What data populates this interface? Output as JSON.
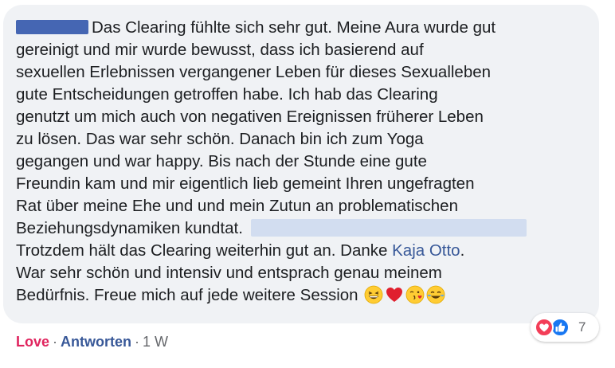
{
  "comment": {
    "lines": [
      "Das Clearing fühlte sich sehr gut. Meine Aura wurde gut",
      "gereinigt und mir wurde bewusst, dass ich basierend auf",
      "sexuellen Erlebnissen vergangener Leben für dieses Sexualleben",
      "gute Entscheidungen getroffen habe. Ich hab das Clearing",
      "genutzt um mich auch von negativen Ereignissen früherer Leben",
      "zu lösen. Das war sehr schön. Danach bin ich zum Yoga",
      "gegangen und war happy. Bis nach der Stunde eine gute",
      "Freundin kam und mir eigentlich lieb gemeint Ihren ungefragten",
      "Rat über meine Ehe und und mein Zutun an problematischen",
      "Beziehungsdynamiken kundtat.",
      "Trotzdem hält das Clearing weiterhin gut an. Danke ",
      "War sehr schön und intensiv und entsprach genau meinem",
      "Bedürfnis. Freue mich auf jede weitere Session"
    ],
    "mention": "Kaja Otto",
    "mention_suffix": ".",
    "emojis": [
      "grinning-squinting-face",
      "red-heart",
      "face-blowing-kiss",
      "face-with-tears-of-joy"
    ]
  },
  "reactions": {
    "types": [
      "love",
      "like"
    ],
    "count": "7"
  },
  "actions": {
    "love": "Love",
    "separator": "·",
    "reply": "Antworten",
    "time": "1 W"
  },
  "colors": {
    "bubble": "#f0f2f5",
    "text": "#1c1e21",
    "link": "#385898",
    "love": "#e0245e",
    "meta": "#65676b"
  }
}
